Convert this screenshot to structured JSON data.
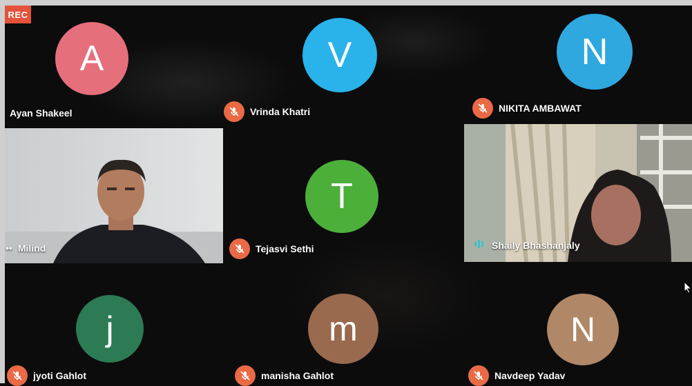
{
  "recording": {
    "label": "REC"
  },
  "participants": [
    {
      "name": "Ayan Shakeel",
      "initial": "A",
      "avatar_color": "#e66f7c",
      "muted": false
    },
    {
      "name": "Vrinda Khatri",
      "initial": "V",
      "avatar_color": "#29b3ea",
      "muted": true
    },
    {
      "name": "NIKITA AMBAWAT",
      "initial": "N",
      "avatar_color": "#2fa8df",
      "muted": true
    },
    {
      "name": "Milind",
      "video": true,
      "muted": false
    },
    {
      "name": "Tejasvi Sethi",
      "initial": "T",
      "avatar_color": "#4caf3a",
      "muted": true
    },
    {
      "name": "Shaily Bhashanjaly",
      "video": true,
      "speaking": true
    },
    {
      "name": "jyoti Gahlot",
      "initial": "j",
      "avatar_color": "#2c7b55",
      "muted": true
    },
    {
      "name": "manisha Gahlot",
      "initial": "m",
      "avatar_color": "#9a6a4e",
      "muted": true
    },
    {
      "name": "Navdeep Yadav",
      "initial": "N",
      "avatar_color": "#b08868",
      "muted": true
    }
  ],
  "colors": {
    "mic_muted": "#ea6a45",
    "rec": "#e2533a",
    "speaking": "#3fc1c9"
  }
}
